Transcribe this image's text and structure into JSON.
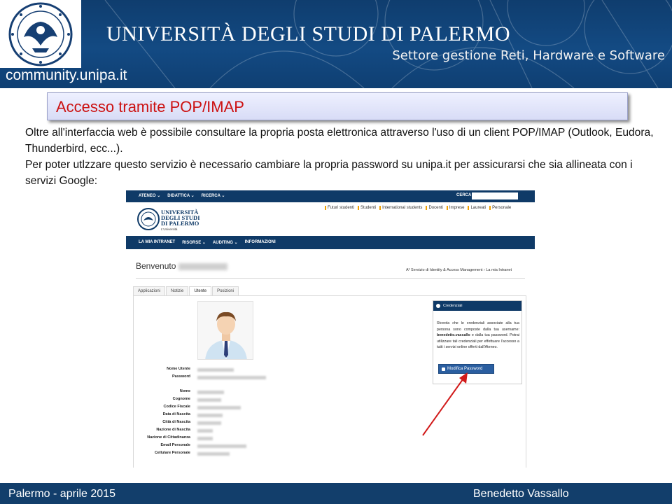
{
  "header": {
    "university_title": "UNIVERSITÀ DEGLI STUDI DI PALERMO",
    "sector": "Settore gestione Reti, Hardware e Software",
    "community_link": "community.unipa.it",
    "logo_icon": "university-seal-icon"
  },
  "slide": {
    "title": "Accesso tramite POP/IMAP",
    "paragraph1": "Oltre all'interfaccia web è possibile consultare la propria posta elettronica attraverso l'uso di un client POP/IMAP (Outlook, Eudora, Thunderbird, ecc...).",
    "paragraph2": "Per poter utlzzare questo servizio è necessario cambiare la propria password su unipa.it per assicurarsi che sia allineata con i servizi Google:"
  },
  "portal": {
    "top_nav": [
      "ATENEO ⌄",
      "DIDATTICA ⌄",
      "RICERCA ⌄"
    ],
    "search_label": "CERCA",
    "audience_links": [
      "Futuri studenti",
      "Studenti",
      "International students",
      "Docenti",
      "Imprese",
      "Laureati",
      "Personale"
    ],
    "logo_text": "UNIVERSITÀ DEGLI STUDI DI PALERMO",
    "logo_subtitle": "L'Università",
    "nav": [
      "LA MIA INTRANET",
      "RISORSE ⌄",
      "AUDITING ⌄",
      "INFORMAZIONI"
    ],
    "welcome": "Benvenuto",
    "breadcrumb": "A³ Servizio di Identity & Access Management  ›  La mia Intranet",
    "tabs": [
      "Applicazioni",
      "Notizie",
      "Utente",
      "Posizioni"
    ],
    "active_tab": "Utente",
    "fields": [
      "Nome Utente",
      "Password",
      "Nome",
      "Cognome",
      "Codice Fiscale",
      "Data di Nascita",
      "Città di Nascita",
      "Nazione di Nascita",
      "Nazione di Cittadinanza",
      "Email Personale",
      "Cellulare Personale"
    ],
    "credentials": {
      "title": "Credenziali",
      "text_before": "Ricorda che le credenziali associate alla tua persona sono composte dalla tua username: ",
      "username": "benedetto.vassallo",
      "text_after": " e dalla tua password. Potrai utilizzare tali credenziali per effettuare l'accesso a tutti i servizi online offerti dall'Ateneo.",
      "button": "Modifica Password"
    }
  },
  "footer": {
    "left": "Palermo  - aprile 2015",
    "right": "Benedetto Vassallo"
  }
}
